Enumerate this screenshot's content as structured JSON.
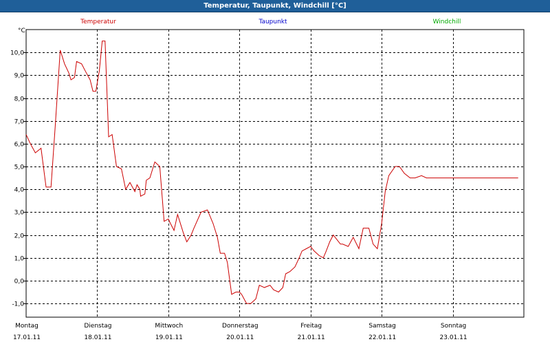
{
  "window": {
    "title": "Temperatur, Taupunkt, Windchill [°C]"
  },
  "colors": {
    "title_bar": "#1f5f99",
    "temperatur": "#cc0000",
    "taupunkt": "#0000cc",
    "windchill": "#00aa00",
    "grid": "#000000"
  },
  "chart_data": {
    "type": "line",
    "title": "Temperatur, Taupunkt, Windchill [°C]",
    "ylabel": "°C",
    "xlabel": "",
    "ylim": [
      -1.6,
      11.0
    ],
    "y_ticks": [
      "10,0",
      "9,0",
      "8,0",
      "7,0",
      "6,0",
      "5,0",
      "4,0",
      "3,0",
      "2,0",
      "1,0",
      "0,0",
      "-1,0"
    ],
    "y_tick_values": [
      10,
      9,
      8,
      7,
      6,
      5,
      4,
      3,
      2,
      1,
      0,
      -1
    ],
    "xlim": [
      0,
      7
    ],
    "x_ticks": [
      {
        "day": "Montag",
        "date": "17.01.11"
      },
      {
        "day": "Dienstag",
        "date": "18.01.11"
      },
      {
        "day": "Mittwoch",
        "date": "19.01.11"
      },
      {
        "day": "Donnerstag",
        "date": "20.01.11"
      },
      {
        "day": "Freitag",
        "date": "21.01.11"
      },
      {
        "day": "Samstag",
        "date": "22.01.11"
      },
      {
        "day": "Sonntag",
        "date": "23.01.11"
      }
    ],
    "grid": true,
    "legend": [
      "Temperatur",
      "Taupunkt",
      "Windchill"
    ],
    "series": [
      {
        "name": "Temperatur",
        "color": "#cc0000",
        "x": [
          0.0,
          0.06,
          0.13,
          0.21,
          0.28,
          0.35,
          0.41,
          0.48,
          0.54,
          0.6,
          0.63,
          0.68,
          0.71,
          0.78,
          0.83,
          0.9,
          0.94,
          0.98,
          1.03,
          1.07,
          1.11,
          1.16,
          1.21,
          1.27,
          1.34,
          1.4,
          1.46,
          1.53,
          1.56,
          1.6,
          1.61,
          1.67,
          1.69,
          1.74,
          1.81,
          1.88,
          1.94,
          2.0,
          2.03,
          2.08,
          2.13,
          2.21,
          2.26,
          2.32,
          2.36,
          2.46,
          2.55,
          2.63,
          2.69,
          2.73,
          2.79,
          2.83,
          2.89,
          2.95,
          3.0,
          3.03,
          3.1,
          3.16,
          3.23,
          3.28,
          3.35,
          3.43,
          3.48,
          3.55,
          3.61,
          3.65,
          3.71,
          3.78,
          3.84,
          3.88,
          3.94,
          4.0,
          4.05,
          4.12,
          4.18,
          4.22,
          4.27,
          4.32,
          4.37,
          4.42,
          4.45,
          4.53,
          4.6,
          4.68,
          4.74,
          4.82,
          4.88,
          4.94,
          5.0,
          5.05,
          5.1,
          5.19,
          5.25,
          5.32,
          5.4,
          5.47,
          5.56,
          5.63,
          5.68,
          5.73,
          5.81,
          5.88,
          5.94,
          5.98,
          6.0,
          6.06,
          6.11,
          6.18,
          6.26,
          6.3,
          6.35,
          6.4,
          6.48,
          6.55,
          6.6,
          6.68,
          6.73,
          6.8,
          6.86,
          6.89,
          6.92
        ],
        "values": [
          6.4,
          6.0,
          5.6,
          5.8,
          4.1,
          4.1,
          6.8,
          10.1,
          9.5,
          9.1,
          8.8,
          8.9,
          9.6,
          9.5,
          9.2,
          8.8,
          8.3,
          8.3,
          9.2,
          10.5,
          10.5,
          6.3,
          6.4,
          5.0,
          4.9,
          4.0,
          4.3,
          3.9,
          4.2,
          4.0,
          3.7,
          3.8,
          4.4,
          4.5,
          5.2,
          5.0,
          2.6,
          2.7,
          2.5,
          2.2,
          2.9,
          2.1,
          1.7,
          2.0,
          2.3,
          3.0,
          3.1,
          2.5,
          1.9,
          1.2,
          1.2,
          0.8,
          -0.6,
          -0.5,
          -0.5,
          -0.6,
          -1.0,
          -1.0,
          -0.8,
          -0.2,
          -0.3,
          -0.2,
          -0.4,
          -0.5,
          -0.3,
          0.3,
          0.4,
          0.6,
          1.0,
          1.3,
          1.4,
          1.5,
          1.3,
          1.1,
          1.0,
          1.3,
          1.7,
          2.0,
          1.8,
          1.6,
          1.6,
          1.5,
          1.9,
          1.4,
          2.3,
          2.3,
          1.6,
          1.4,
          2.5,
          3.9,
          4.6,
          5.0,
          5.0,
          4.7,
          4.5,
          4.5,
          4.6,
          4.5,
          4.5,
          4.5,
          4.5,
          4.5,
          4.5,
          4.5,
          4.5,
          4.5,
          4.5,
          4.5,
          4.5,
          4.5,
          4.5,
          4.5,
          4.5,
          4.5,
          4.5,
          4.5,
          4.5,
          4.5,
          4.5,
          4.5,
          4.5
        ]
      }
    ]
  }
}
